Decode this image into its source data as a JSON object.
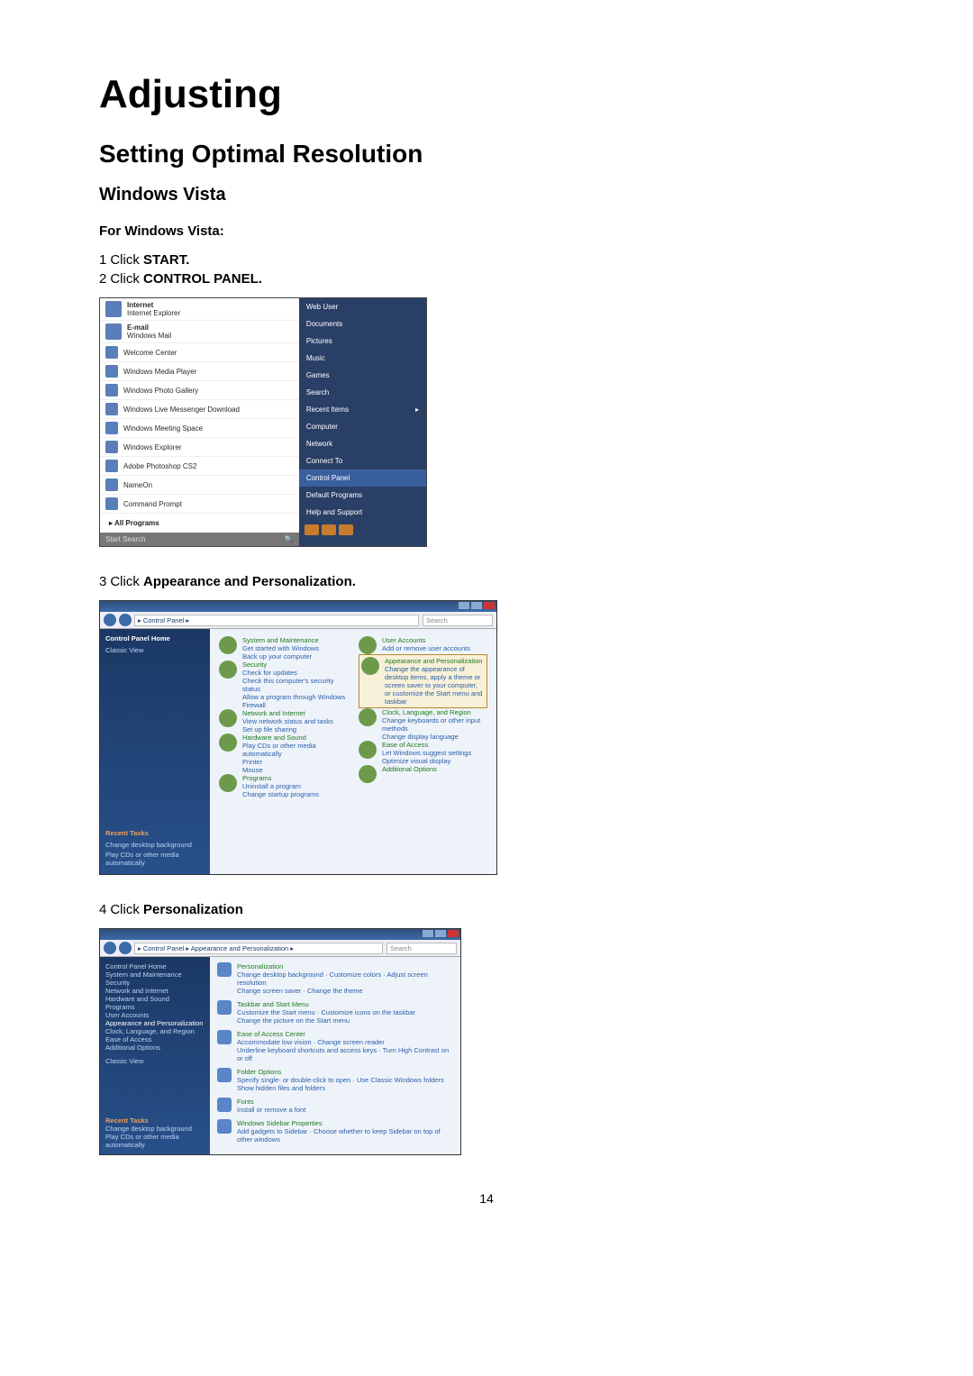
{
  "h1": "Adjusting",
  "h2": "Setting Optimal Resolution",
  "h3": "Windows Vista",
  "intro": "For Windows Vista:",
  "steps": {
    "s1": {
      "n": "1",
      "t": "Click ",
      "b": "START."
    },
    "s2": {
      "n": "2",
      "t": "Click ",
      "b": "CONTROL PANEL."
    },
    "s3": {
      "n": "3",
      "t": "Click ",
      "b": "Appearance and Personalization."
    },
    "s4": {
      "n": "4",
      "t": "Click ",
      "b": "Personalization"
    }
  },
  "page_number": "14",
  "start_menu": {
    "pinned": [
      {
        "title": "Internet",
        "sub": "Internet Explorer"
      },
      {
        "title": "E-mail",
        "sub": "Windows Mail"
      }
    ],
    "recent": [
      "Welcome Center",
      "Windows Media Player",
      "Windows Photo Gallery",
      "Windows Live Messenger Download",
      "Windows Meeting Space",
      "Windows Explorer",
      "Adobe Photoshop CS2",
      "NameOn",
      "Command Prompt"
    ],
    "all_programs": "All Programs",
    "search_placeholder": "Start Search",
    "right": [
      "Web User",
      "Documents",
      "Pictures",
      "Music",
      "Games",
      "Search",
      "Recent Items",
      "Computer",
      "Network",
      "Connect To",
      "Control Panel",
      "Default Programs",
      "Help and Support"
    ],
    "right_highlight_index": 10
  },
  "control_panel": {
    "breadcrumb": "▸ Control Panel ▸",
    "side": {
      "header": "Control Panel Home",
      "links": [
        "Classic View"
      ],
      "recent_header": "Recent Tasks",
      "recent": [
        "Change desktop background",
        "Play CDs or other media automatically"
      ]
    },
    "categories": {
      "left": [
        {
          "title": "System and Maintenance",
          "subs": [
            "Get started with Windows",
            "Back up your computer"
          ]
        },
        {
          "title": "Security",
          "subs": [
            "Check for updates",
            "Check this computer's security status",
            "Allow a program through Windows Firewall"
          ]
        },
        {
          "title": "Network and Internet",
          "subs": [
            "View network status and tasks",
            "Set up file sharing"
          ]
        },
        {
          "title": "Hardware and Sound",
          "subs": [
            "Play CDs or other media automatically",
            "Printer",
            "Mouse"
          ]
        },
        {
          "title": "Programs",
          "subs": [
            "Uninstall a program",
            "Change startup programs"
          ]
        }
      ],
      "right": [
        {
          "title": "User Accounts",
          "subs": [
            "Add or remove user accounts"
          ]
        },
        {
          "title": "Appearance and Personalization",
          "subs": [
            "Change the appearance of desktop items, apply a theme or screen saver to your computer, or customize the Start menu and taskbar"
          ],
          "highlight": true
        },
        {
          "title": "Clock, Language, and Region",
          "subs": [
            "Change keyboards or other input methods",
            "Change display language"
          ]
        },
        {
          "title": "Ease of Access",
          "subs": [
            "Let Windows suggest settings",
            "Optimize visual display"
          ]
        },
        {
          "title": "Additional Options",
          "subs": []
        }
      ]
    }
  },
  "appearance": {
    "breadcrumb": "▸ Control Panel ▸ Appearance and Personalization ▸",
    "side_links": [
      "Control Panel Home",
      "System and Maintenance",
      "Security",
      "Network and Internet",
      "Hardware and Sound",
      "Programs",
      "User Accounts",
      "Appearance and Personalization",
      "Clock, Language, and Region",
      "Ease of Access",
      "Additional Options"
    ],
    "side_links_current_index": 7,
    "side_classic": "Classic View",
    "recent_header": "Recent Tasks",
    "recent": [
      "Change desktop background",
      "Play CDs or other media automatically"
    ],
    "items": [
      {
        "title": "Personalization",
        "subs": [
          "Change desktop background",
          "Customize colors",
          "Adjust screen resolution",
          "Change screen saver",
          "Change the theme"
        ]
      },
      {
        "title": "Taskbar and Start Menu",
        "subs": [
          "Customize the Start menu",
          "Customize icons on the taskbar",
          "Change the picture on the Start menu"
        ]
      },
      {
        "title": "Ease of Access Center",
        "subs": [
          "Accommodate low vision",
          "Change screen reader",
          "Underline keyboard shortcuts and access keys",
          "Turn High Contrast on or off"
        ]
      },
      {
        "title": "Folder Options",
        "subs": [
          "Specify single- or double-click to open",
          "Use Classic Windows folders",
          "Show hidden files and folders"
        ]
      },
      {
        "title": "Fonts",
        "subs": [
          "Install or remove a font"
        ]
      },
      {
        "title": "Windows Sidebar Properties",
        "subs": [
          "Add gadgets to Sidebar",
          "Choose whether to keep Sidebar on top of other windows"
        ]
      }
    ]
  }
}
